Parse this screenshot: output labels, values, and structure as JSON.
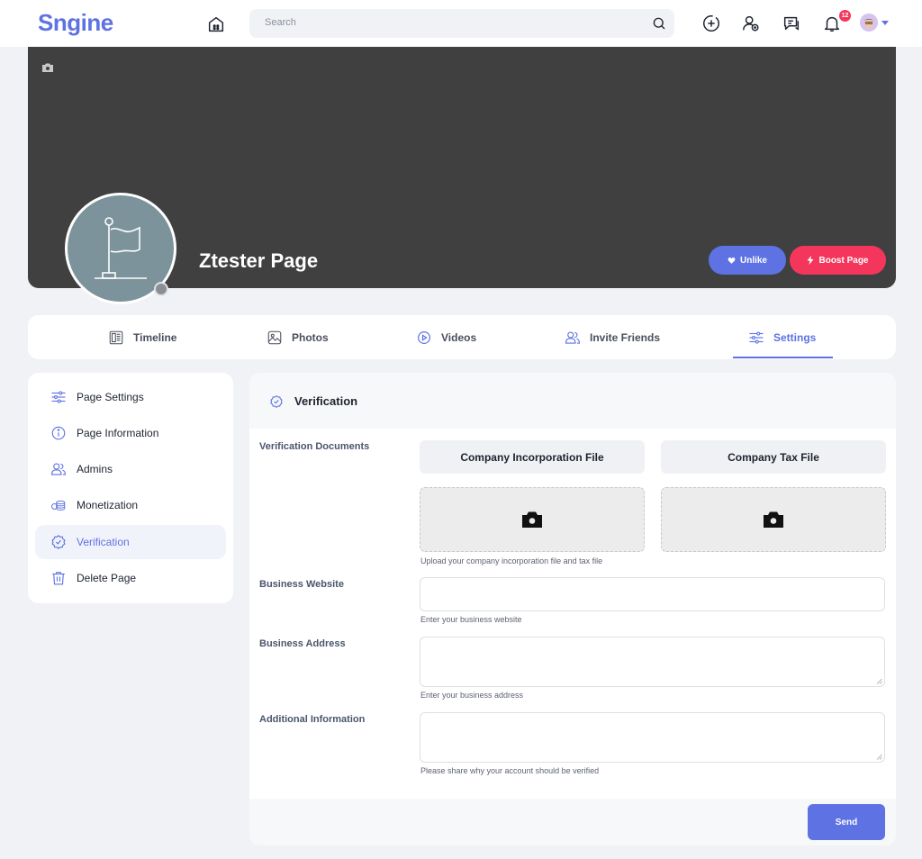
{
  "header": {
    "logo": "Sngine",
    "search_placeholder": "Search",
    "notification_count": "12"
  },
  "page": {
    "name": "Ztester Page",
    "unlike_label": "Unlike",
    "boost_label": "Boost Page"
  },
  "tabs": [
    {
      "label": "Timeline",
      "icon": "timeline-icon"
    },
    {
      "label": "Photos",
      "icon": "photos-icon"
    },
    {
      "label": "Videos",
      "icon": "videos-icon"
    },
    {
      "label": "Invite Friends",
      "icon": "invite-friends-icon"
    },
    {
      "label": "Settings",
      "icon": "settings-icon",
      "active": true
    }
  ],
  "sidebar": {
    "items": [
      {
        "label": "Page Settings",
        "icon": "sliders-icon"
      },
      {
        "label": "Page Information",
        "icon": "info-icon"
      },
      {
        "label": "Admins",
        "icon": "admins-icon"
      },
      {
        "label": "Monetization",
        "icon": "coins-icon"
      },
      {
        "label": "Verification",
        "icon": "verified-badge-icon",
        "active": true
      },
      {
        "label": "Delete Page",
        "icon": "trash-icon"
      }
    ]
  },
  "verification": {
    "title": "Verification",
    "documents_label": "Verification Documents",
    "doc_tabs": [
      "Company Incorporation File",
      "Company Tax File"
    ],
    "upload_help": "Upload your company incorporation file and tax file",
    "website_label": "Business Website",
    "website_value": "",
    "website_help": "Enter your business website",
    "address_label": "Business Address",
    "address_value": "",
    "address_help": "Enter your business address",
    "info_label": "Additional Information",
    "info_value": "",
    "info_help": "Please share why your account should be verified",
    "send_label": "Send"
  },
  "colors": {
    "accent": "#5e72e4",
    "danger": "#f5365c",
    "cover": "#404040",
    "page_bg": "#f0f2f5"
  }
}
